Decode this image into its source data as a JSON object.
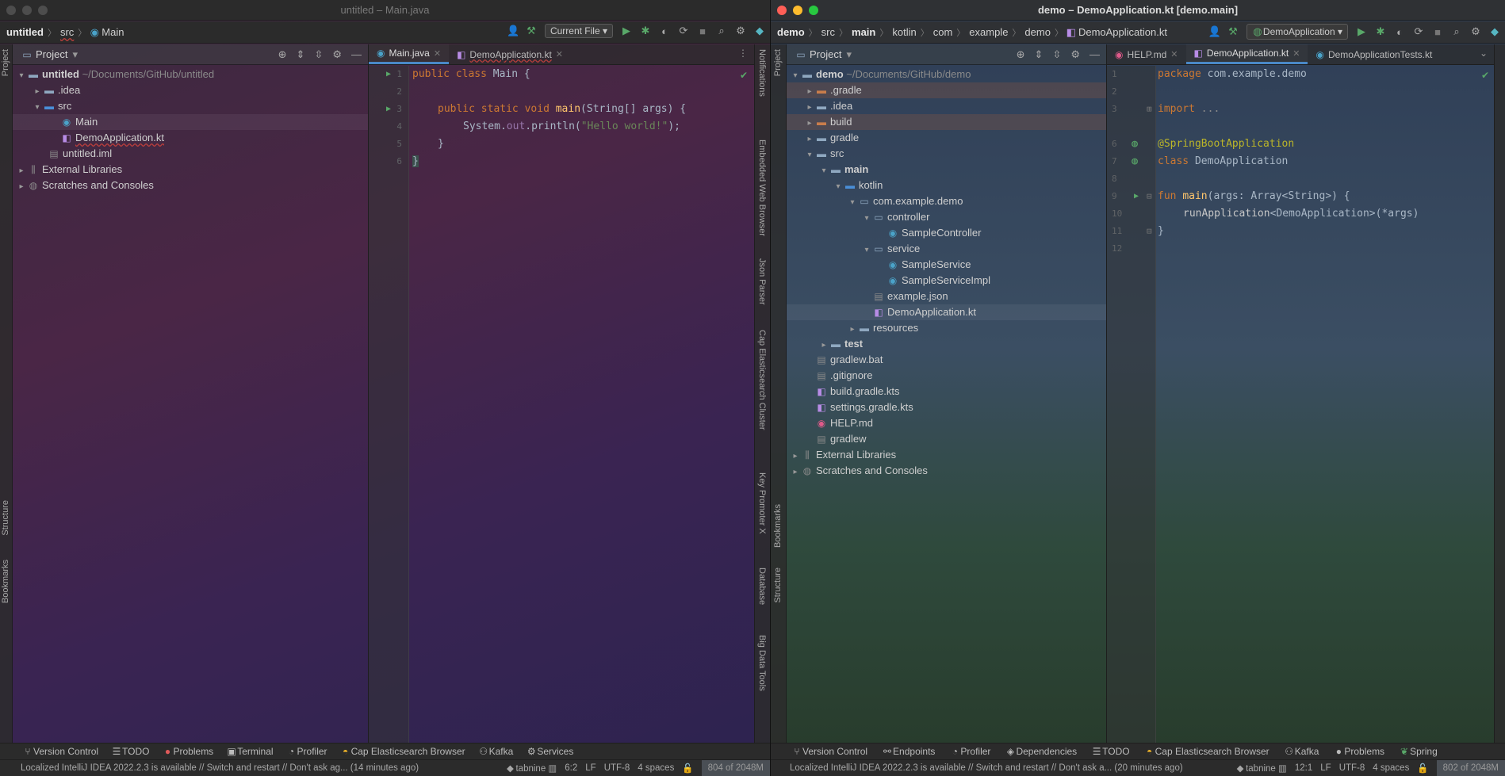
{
  "left": {
    "title": "untitled – Main.java",
    "breadcrumbs": [
      "untitled",
      "src",
      "Main"
    ],
    "run_config": "Current File",
    "panel_title": "Project",
    "tree": [
      {
        "label": "untitled",
        "suffix": "~/Documents/GitHub/untitled",
        "icon": "folder-icon"
      },
      {
        "label": ".idea",
        "icon": "folder-icon"
      },
      {
        "label": "src",
        "icon": "folder-icon"
      },
      {
        "label": "Main",
        "icon": "java-class-icon"
      },
      {
        "label": "DemoApplication.kt",
        "icon": "kotlin-file-icon"
      },
      {
        "label": "untitled.iml",
        "icon": "iml-file-icon"
      },
      {
        "label": "External Libraries",
        "icon": "libraries-icon"
      },
      {
        "label": "Scratches and Consoles",
        "icon": "scratches-icon"
      }
    ],
    "tabs": [
      "Main.java",
      "DemoApplication.kt"
    ],
    "line_numbers": [
      "1",
      "2",
      "3",
      "4",
      "5",
      "6"
    ],
    "code": {
      "l1": [
        "public",
        "class",
        "Main",
        "{"
      ],
      "l3": [
        "public",
        "static",
        "void",
        "main",
        "(String[] args) {"
      ],
      "l4": [
        "System.",
        "out",
        ".println(",
        "\"Hello world!\"",
        ");"
      ],
      "l5": "}",
      "l6": "}"
    },
    "right_strip": [
      "Notifications",
      "Embedded Web Browser",
      "Json Parser",
      "Cap Elasticsearch Cluster",
      "Key Promoter X",
      "Database",
      "Big Data Tools"
    ],
    "left_strip": [
      "Project",
      "Structure",
      "Bookmarks"
    ],
    "bottom_tools": [
      "Version Control",
      "TODO",
      "Problems",
      "Terminal",
      "Profiler",
      "Cap Elasticsearch Browser",
      "Kafka",
      "Services"
    ],
    "status": {
      "message": "Localized IntelliJ IDEA 2022.2.3 is available // Switch and restart // Don't ask ag... (14 minutes ago)",
      "tabnine": "tabnine",
      "position": "6:2",
      "line_sep": "LF",
      "encoding": "UTF-8",
      "indent": "4 spaces",
      "memory": "804 of 2048M"
    }
  },
  "right": {
    "title": "demo – DemoApplication.kt [demo.main]",
    "breadcrumbs": [
      "demo",
      "src",
      "main",
      "kotlin",
      "com",
      "example",
      "demo",
      "DemoApplication.kt"
    ],
    "run_config": "DemoApplication",
    "panel_title": "Project",
    "tree": [
      {
        "label": "demo",
        "suffix": "~/Documents/GitHub/demo"
      },
      {
        "label": ".gradle"
      },
      {
        "label": ".idea"
      },
      {
        "label": "build"
      },
      {
        "label": "gradle"
      },
      {
        "label": "src"
      },
      {
        "label": "main"
      },
      {
        "label": "kotlin"
      },
      {
        "label": "com.example.demo"
      },
      {
        "label": "controller"
      },
      {
        "label": "SampleController"
      },
      {
        "label": "service"
      },
      {
        "label": "SampleService"
      },
      {
        "label": "SampleServiceImpl"
      },
      {
        "label": "example.json"
      },
      {
        "label": "DemoApplication.kt"
      },
      {
        "label": "resources"
      },
      {
        "label": "test"
      },
      {
        "label": "gradlew.bat"
      },
      {
        "label": ".gitignore"
      },
      {
        "label": "build.gradle.kts"
      },
      {
        "label": "settings.gradle.kts"
      },
      {
        "label": "HELP.md"
      },
      {
        "label": "gradlew"
      },
      {
        "label": "External Libraries"
      },
      {
        "label": "Scratches and Consoles"
      }
    ],
    "tabs": [
      "HELP.md",
      "DemoApplication.kt",
      "DemoApplicationTests.kt"
    ],
    "line_numbers": [
      "1",
      "2",
      "3",
      "",
      "6",
      "7",
      "8",
      "9",
      "10",
      "11",
      "12"
    ],
    "code": {
      "l1": [
        "package",
        "com.example.demo"
      ],
      "l3": [
        "import",
        "..."
      ],
      "l6": "@SpringBootApplication",
      "l7": [
        "class",
        "DemoApplication"
      ],
      "l9": [
        "fun",
        "main",
        "(args: Array<String>) {"
      ],
      "l10": [
        "runApplication",
        "<DemoApplication>",
        "(*args)"
      ],
      "l11": "}"
    },
    "left_strip": [
      "Project",
      "Bookmarks",
      "Structure"
    ],
    "bottom_tools": [
      "Version Control",
      "Endpoints",
      "Profiler",
      "Dependencies",
      "TODO",
      "Cap Elasticsearch Browser",
      "Kafka",
      "Problems",
      "Spring"
    ],
    "status": {
      "message": "Localized IntelliJ IDEA 2022.2.3 is available // Switch and restart // Don't ask a... (20 minutes ago)",
      "tabnine": "tabnine",
      "position": "12:1",
      "line_sep": "LF",
      "encoding": "UTF-8",
      "indent": "4 spaces",
      "memory": "802 of 2048M"
    }
  }
}
